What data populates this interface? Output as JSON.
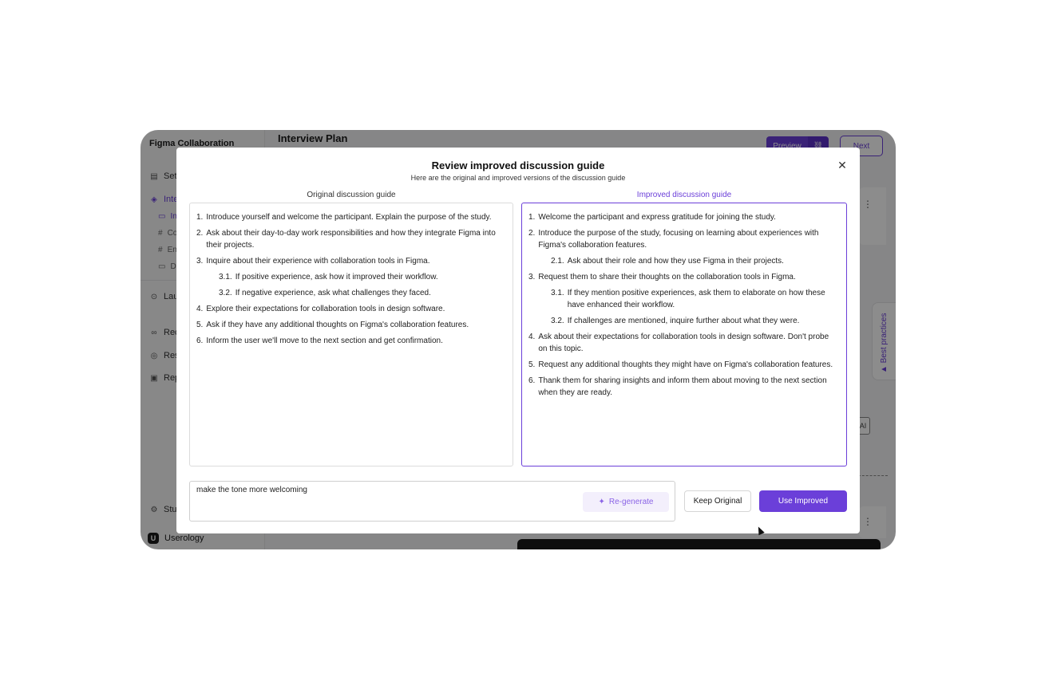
{
  "sidebar": {
    "project": "Figma Collaboration",
    "items": [
      {
        "label": "Set",
        "icon": "document-icon"
      },
      {
        "label": "Inte",
        "icon": "layers-icon"
      },
      {
        "label": "Lau",
        "icon": "play-circle-icon"
      },
      {
        "label": "Rec",
        "icon": "voicemail-icon"
      },
      {
        "label": "Res",
        "icon": "target-icon"
      },
      {
        "label": "Rep",
        "icon": "clipboard-icon"
      },
      {
        "label": "Stu",
        "icon": "gear-icon"
      }
    ],
    "subitems": [
      "In",
      "Co",
      "En",
      "De"
    ],
    "brand": "Userology"
  },
  "header": {
    "title": "Interview Plan",
    "preview_label": "Preview",
    "next_label": "Next"
  },
  "best_practices_label": "▲ Best practices",
  "ai_chip_label": "AI",
  "modal": {
    "title": "Review improved discussion guide",
    "subtitle": "Here are the original and improved versions of the discussion guide",
    "original_heading": "Original discussion guide",
    "improved_heading": "Improved discussion guide",
    "original_items": [
      {
        "num": "1.",
        "text": "Introduce yourself and welcome the participant. Explain the purpose of the study."
      },
      {
        "num": "2.",
        "text": "Ask about their day-to-day work responsibilities and how they integrate Figma into their projects."
      },
      {
        "num": "3.",
        "text": "Inquire about their experience with collaboration tools in Figma."
      },
      {
        "num": "3.1.",
        "text": "If positive experience, ask how it improved their workflow.",
        "sub": true
      },
      {
        "num": "3.2.",
        "text": "If negative experience, ask what challenges they faced.",
        "sub": true
      },
      {
        "num": "4.",
        "text": "Explore their expectations for collaboration tools in design software."
      },
      {
        "num": "5.",
        "text": "Ask if they have any additional thoughts on Figma's collaboration features."
      },
      {
        "num": "6.",
        "text": "Inform the user we'll move to the next section and get confirmation."
      }
    ],
    "improved_items": [
      {
        "num": "1.",
        "text": "Welcome the participant and express gratitude for joining the study."
      },
      {
        "num": "2.",
        "text": "Introduce the purpose of the study, focusing on learning about experiences with Figma's collaboration features."
      },
      {
        "num": "2.1.",
        "text": "Ask about their role and how they use Figma in their projects.",
        "sub": true
      },
      {
        "num": "3.",
        "text": "Request them to share their thoughts on the collaboration tools in Figma."
      },
      {
        "num": "3.1.",
        "text": "If they mention positive experiences, ask them to elaborate on how these have enhanced their workflow.",
        "sub": true
      },
      {
        "num": "3.2.",
        "text": "If challenges are mentioned, inquire further about what they were.",
        "sub": true
      },
      {
        "num": "4.",
        "text": "Ask about their expectations for collaboration tools in design software. Don't probe on this topic."
      },
      {
        "num": "5.",
        "text": "Request any additional thoughts they might have on Figma's collaboration features."
      },
      {
        "num": "6.",
        "text": "Thank them for sharing insights and inform them about moving to the next section when they are ready."
      }
    ],
    "prompt_value": "make the tone more welcoming",
    "regenerate_label": "Re-generate",
    "keep_label": "Keep Original",
    "use_label": "Use Improved",
    "close_icon": "close-icon"
  },
  "colors": {
    "accent": "#6b3fd9",
    "overlay": "rgba(0,0,0,0.45)"
  }
}
